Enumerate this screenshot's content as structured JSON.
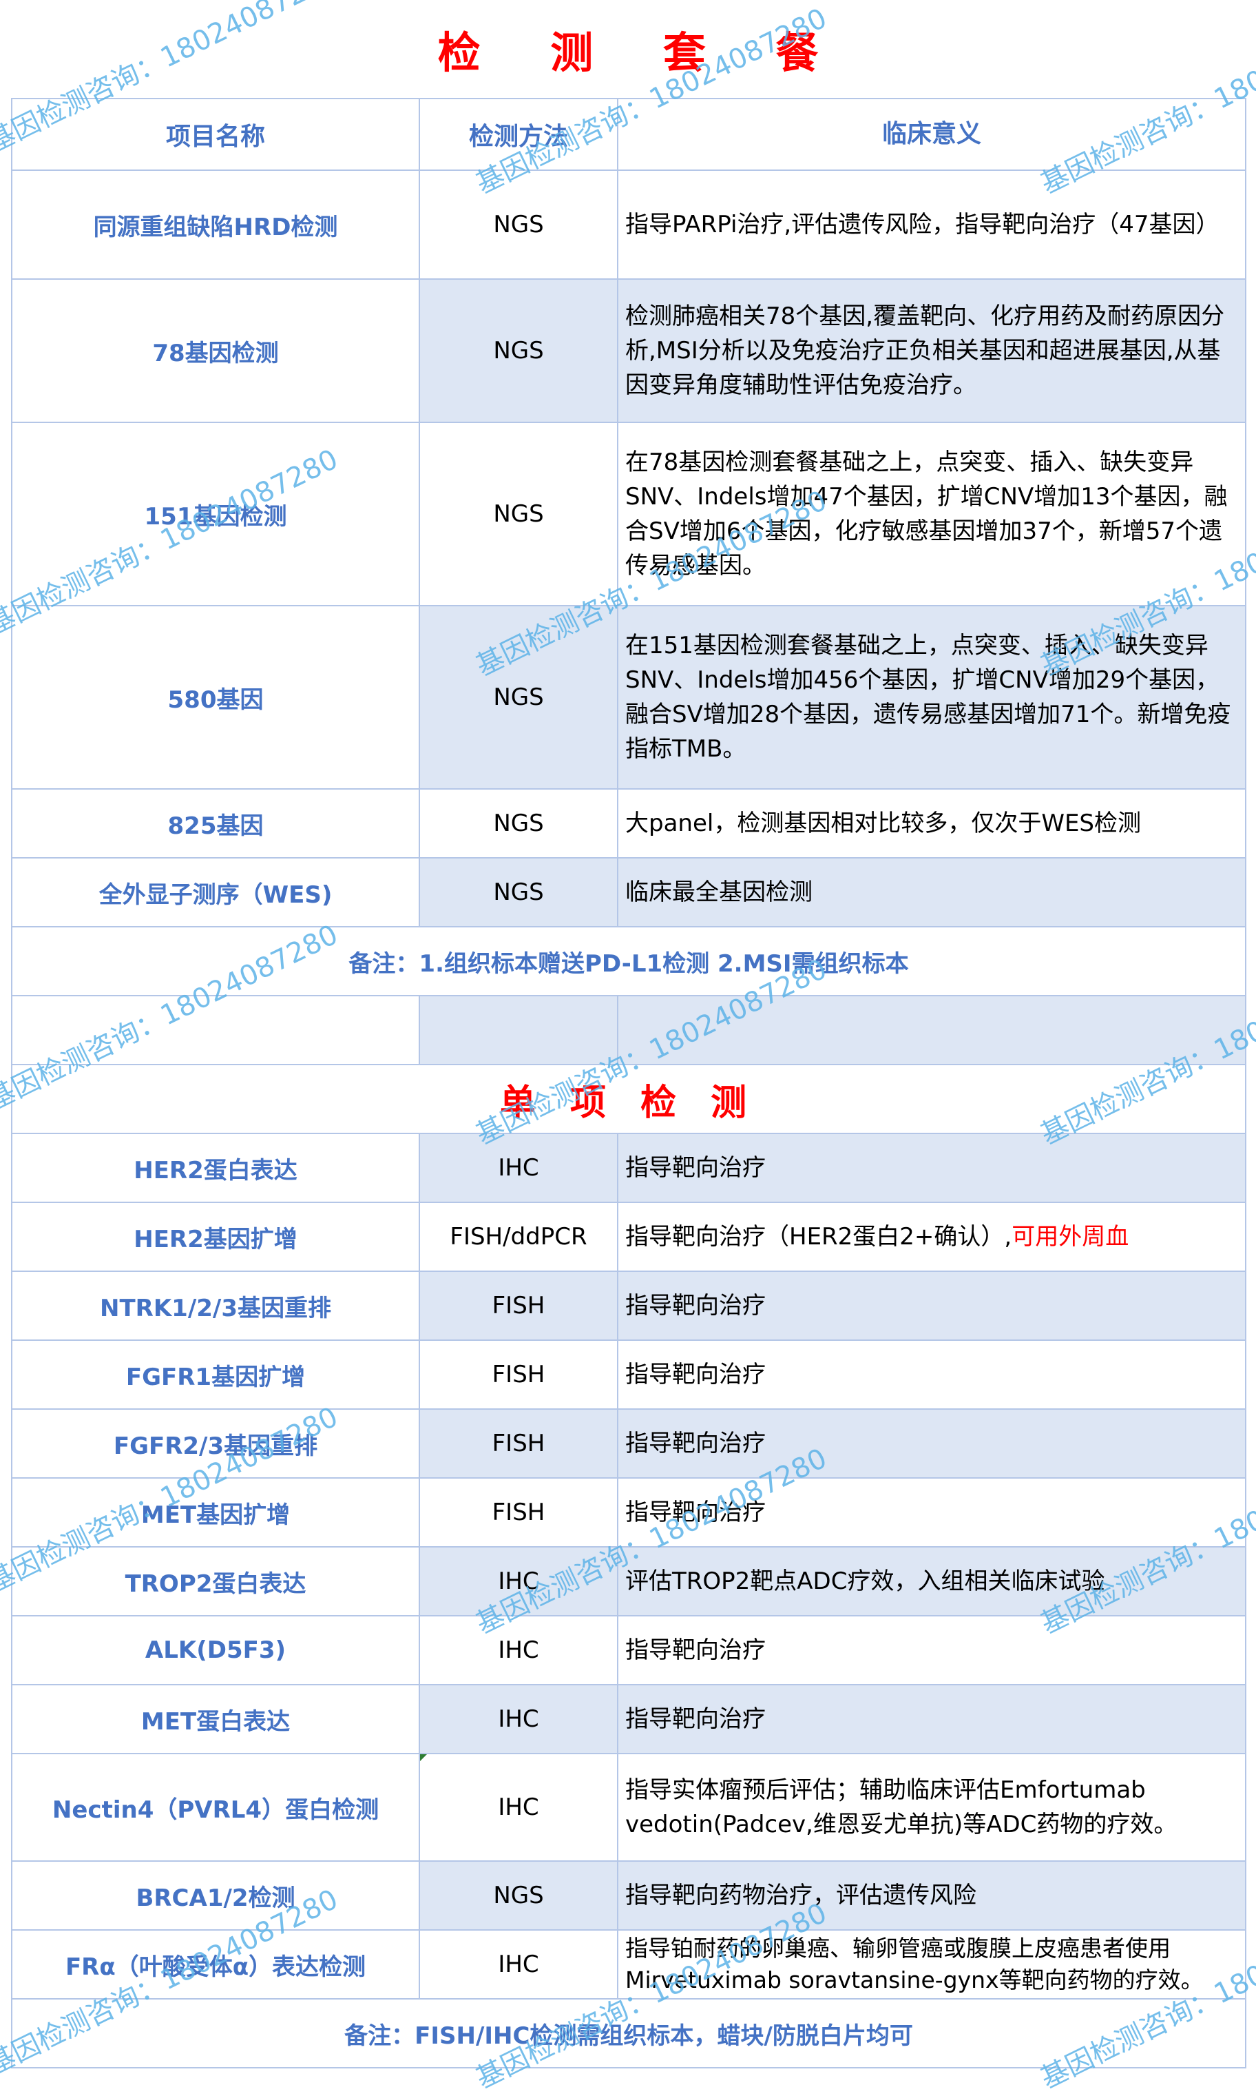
{
  "title": "检 测 套 餐",
  "headers": {
    "name": "项目名称",
    "method": "检测方法",
    "meaning": "临床意义"
  },
  "panels": [
    {
      "name": "同源重组缺陷HRD检测",
      "method": "NGS",
      "meaning": "指导PARPi治疗,评估遗传风险，指导靶向治疗（47基因）"
    },
    {
      "name": "78基因检测",
      "method": "NGS",
      "meaning": "检测肺癌相关78个基因,覆盖靶向、化疗用药及耐药原因分析,MSI分析以及免疫治疗正负相关基因和超进展基因,从基因变异角度辅助性评估免疫治疗。"
    },
    {
      "name": "151基因检测",
      "method": "NGS",
      "meaning": "在78基因检测套餐基础之上，点突变、插入、缺失变异SNV、Indels增加47个基因，扩增CNV增加13个基因，融合SV增加6个基因，化疗敏感基因增加37个，新增57个遗传易感基因。"
    },
    {
      "name": "580基因",
      "method": "NGS",
      "meaning": "在151基因检测套餐基础之上，点突变、插入、缺失变异SNV、Indels增加456个基因，扩增CNV增加29个基因，融合SV增加28个基因，遗传易感基因增加71个。新增免疫指标TMB。"
    },
    {
      "name": "825基因",
      "method": "NGS",
      "meaning": "大panel，检测基因相对比较多，仅次于WES检测"
    },
    {
      "name": "全外显子测序（WES)",
      "method": "NGS",
      "meaning": "临床最全基因检测"
    }
  ],
  "panel_note": "备注：1.组织标本赠送PD-L1检测 2.MSI需组织标本",
  "section2_title": "单 项 检 测",
  "single": [
    {
      "name": "HER2蛋白表达",
      "method": "IHC",
      "meaning": "指导靶向治疗"
    },
    {
      "name": "HER2基因扩增",
      "method": "FISH/ddPCR",
      "meaning": "指导靶向治疗（HER2蛋白2+确认）,",
      "meaning_red": "可用外周血"
    },
    {
      "name": "NTRK1/2/3基因重排",
      "method": "FISH",
      "meaning": "指导靶向治疗"
    },
    {
      "name": "FGFR1基因扩增",
      "method": "FISH",
      "meaning": "指导靶向治疗"
    },
    {
      "name": "FGFR2/3基因重排",
      "method": "FISH",
      "meaning": "指导靶向治疗"
    },
    {
      "name": "MET基因扩增",
      "method": "FISH",
      "meaning": "指导靶向治疗"
    },
    {
      "name": "TROP2蛋白表达",
      "method": "IHC",
      "meaning": "评估TROP2靶点ADC疗效，入组相关临床试验"
    },
    {
      "name": "ALK(D5F3)",
      "method": "IHC",
      "meaning": "指导靶向治疗"
    },
    {
      "name": "MET蛋白表达",
      "method": "IHC",
      "meaning": "指导靶向治疗"
    },
    {
      "name": "Nectin4（PVRL4）蛋白检测",
      "method": "IHC",
      "meaning": "指导实体瘤预后评估；辅助临床评估Emfortumab vedotin(Padcev,维恩妥尤单抗)等ADC药物的疗效。"
    },
    {
      "name": "BRCA1/2检测",
      "method": "NGS",
      "meaning": "指导靶向药物治疗，评估遗传风险"
    },
    {
      "name": "FRα（叶酸受体α）表达检测",
      "method": "IHC",
      "meaning": "指导铂耐药的卵巢癌、输卵管癌或腹膜上皮癌患者使用Mirvetuximab soravtansine-gynx等靶向药物的疗效。"
    }
  ],
  "single_note": "备注：FISH/IHC检测需组织标本，蜡块/防脱白片均可",
  "watermark": "基因检测咨询：18024087280"
}
